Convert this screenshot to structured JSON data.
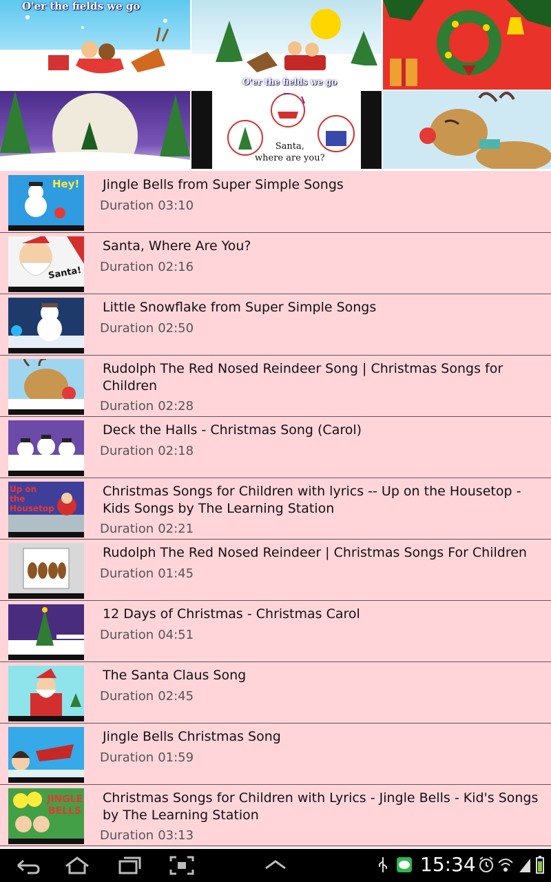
{
  "banner": {
    "tiles": [
      {
        "caption": "O'er the fields we go"
      },
      {
        "caption": "O'er the fields we go"
      },
      {
        "caption": ""
      },
      {
        "caption": ""
      },
      {
        "caption": "Santa,\nwhere are you?"
      },
      {
        "caption": ""
      }
    ]
  },
  "videos": [
    {
      "title": "Jingle Bells from Super Simple Songs",
      "duration_label": "Duration",
      "duration": "03:10",
      "thumb_color": "#2f9be0",
      "thumb_text": "Hey!"
    },
    {
      "title": "Santa, Where Are You?",
      "duration_label": "Duration",
      "duration": "02:16",
      "thumb_color": "#f4f4f4",
      "thumb_text": "Santa!"
    },
    {
      "title": "Little Snowflake from Super Simple Songs",
      "duration_label": "Duration",
      "duration": "02:50",
      "thumb_color": "#1d3a6b",
      "thumb_text": ""
    },
    {
      "title": "Rudolph The Red Nosed Reindeer Song | Christmas Songs for Children",
      "duration_label": "Duration",
      "duration": "02:28",
      "thumb_color": "#9fd6ef",
      "thumb_text": ""
    },
    {
      "title": "Deck the Halls - Christmas Song (Carol)",
      "duration_label": "Duration",
      "duration": "02:18",
      "thumb_color": "#6b4aa8",
      "thumb_text": ""
    },
    {
      "title": "Christmas Songs for Children with lyrics -- Up on the Housetop - Kids Songs by The Learning Station",
      "duration_label": "Duration",
      "duration": "02:21",
      "thumb_color": "#3f3f9a",
      "thumb_text": "Up on the Housetop"
    },
    {
      "title": "Rudolph The Red Nosed Reindeer | Christmas Songs For Children",
      "duration_label": "Duration",
      "duration": "01:45",
      "thumb_color": "#d8d8d8",
      "thumb_text": ""
    },
    {
      "title": "12 Days of Christmas - Christmas Carol",
      "duration_label": "Duration",
      "duration": "04:51",
      "thumb_color": "#4a2c7e",
      "thumb_text": ""
    },
    {
      "title": "The Santa Claus Song",
      "duration_label": "Duration",
      "duration": "02:45",
      "thumb_color": "#8fe3ea",
      "thumb_text": ""
    },
    {
      "title": "Jingle Bells Christmas Song",
      "duration_label": "Duration",
      "duration": "01:59",
      "thumb_color": "#36a9e8",
      "thumb_text": ""
    },
    {
      "title": "Christmas Songs for Children with Lyrics - Jingle Bells - Kid's Songs by The Learning Station",
      "duration_label": "Duration",
      "duration": "03:13",
      "thumb_color": "#43a047",
      "thumb_text": "JINGLE BELLS"
    }
  ],
  "status_bar": {
    "time": "15:34",
    "icons": [
      "back-icon",
      "home-icon",
      "recent-apps-icon",
      "screenshot-icon",
      "up-arrow-icon",
      "usb-icon",
      "line-app-icon",
      "alarm-icon",
      "wifi-icon",
      "signal-icon",
      "battery-icon"
    ]
  },
  "colors": {
    "list_background": "#ffd5da",
    "divider": "#5a5a5a",
    "duration_text": "#555555"
  }
}
